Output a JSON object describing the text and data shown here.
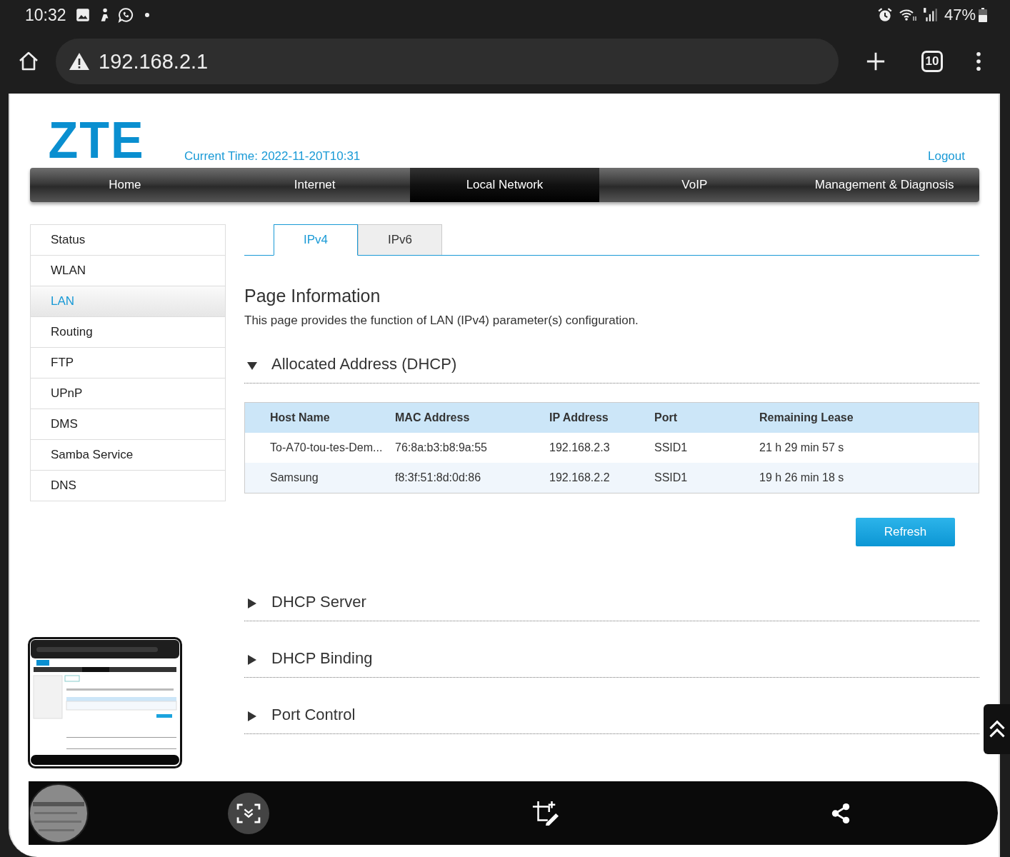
{
  "status_bar": {
    "time": "10:32",
    "battery": "47%"
  },
  "browser": {
    "url": "192.168.2.1",
    "tab_count": "10"
  },
  "header": {
    "logo": "ZTE",
    "current_time": "Current Time: 2022-11-20T10:31",
    "logout": "Logout"
  },
  "nav": [
    {
      "label": "Home",
      "selected": false
    },
    {
      "label": "Internet",
      "selected": false
    },
    {
      "label": "Local Network",
      "selected": true
    },
    {
      "label": "VoIP",
      "selected": false
    },
    {
      "label": "Management & Diagnosis",
      "selected": false
    }
  ],
  "sidebar": {
    "items": [
      {
        "label": "Status",
        "selected": false
      },
      {
        "label": "WLAN",
        "selected": false
      },
      {
        "label": "LAN",
        "selected": true
      },
      {
        "label": "Routing",
        "selected": false
      },
      {
        "label": "FTP",
        "selected": false
      },
      {
        "label": "UPnP",
        "selected": false
      },
      {
        "label": "DMS",
        "selected": false
      },
      {
        "label": "Samba Service",
        "selected": false
      },
      {
        "label": "DNS",
        "selected": false
      }
    ]
  },
  "tabs": [
    {
      "label": "IPv4",
      "selected": true
    },
    {
      "label": "IPv6",
      "selected": false
    }
  ],
  "page_info": {
    "title": "Page Information",
    "description": "This page provides the function of LAN (IPv4) parameter(s) configuration."
  },
  "sections": [
    {
      "title": "Allocated Address (DHCP)",
      "expanded": true,
      "table": {
        "columns": [
          "Host Name",
          "MAC Address",
          "IP Address",
          "Port",
          "Remaining Lease"
        ],
        "rows": [
          [
            "To-A70-tou-tes-Dem...",
            "76:8a:b3:b8:9a:55",
            "192.168.2.3",
            "SSID1",
            "21 h 29 min 57 s"
          ],
          [
            "Samsung",
            "f8:3f:51:8d:0d:86",
            "192.168.2.2",
            "SSID1",
            "19 h 26 min 18 s"
          ]
        ]
      },
      "button": "Refresh"
    },
    {
      "title": "DHCP Server",
      "expanded": false
    },
    {
      "title": "DHCP Binding",
      "expanded": false
    },
    {
      "title": "Port Control",
      "expanded": false
    }
  ]
}
